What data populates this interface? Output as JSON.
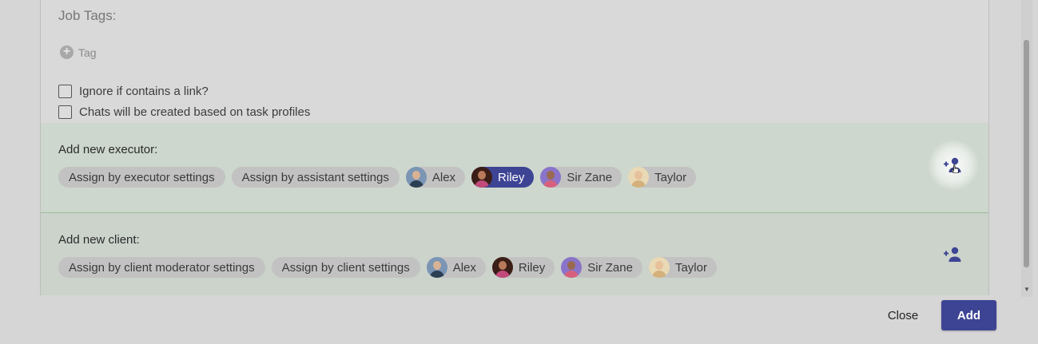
{
  "job_tags": {
    "title": "Job Tags:",
    "add_tag_label": "Tag"
  },
  "options": [
    {
      "label": "Ignore if contains a link?",
      "checked": false
    },
    {
      "label": "Chats will be created based on task profiles",
      "checked": false
    }
  ],
  "executor": {
    "title": "Add new executor:",
    "chips": [
      {
        "label": "Assign by executor settings"
      },
      {
        "label": "Assign by assistant settings"
      }
    ],
    "users": [
      {
        "name": "Alex",
        "selected": false
      },
      {
        "name": "Riley",
        "selected": true
      },
      {
        "name": "Sir Zane",
        "selected": false
      },
      {
        "name": "Taylor",
        "selected": false
      }
    ],
    "add_icon": "add-person-icon"
  },
  "client": {
    "title": "Add new client:",
    "chips": [
      {
        "label": "Assign by client moderator settings"
      },
      {
        "label": "Assign by client settings"
      }
    ],
    "users": [
      {
        "name": "Alex",
        "selected": false
      },
      {
        "name": "Riley",
        "selected": false
      },
      {
        "name": "Sir Zane",
        "selected": false
      },
      {
        "name": "Taylor",
        "selected": false
      }
    ],
    "add_icon": "add-person-icon"
  },
  "footer": {
    "close_label": "Close",
    "add_label": "Add"
  },
  "colors": {
    "accent": "#3d4494",
    "section_bg": "#cdd7cd",
    "chip_bg": "#c2c2c2"
  }
}
